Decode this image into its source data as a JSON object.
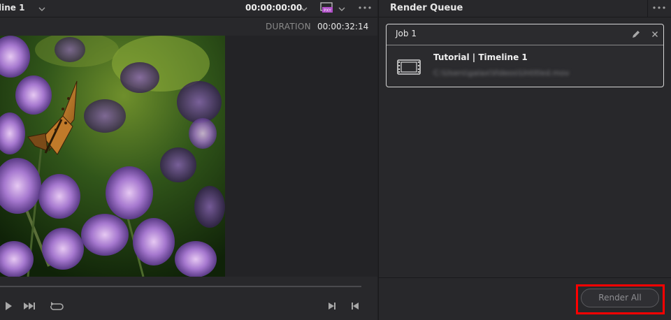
{
  "viewer": {
    "timeline_name": "line 1",
    "timecode": "00:00:00:00",
    "duration_label": "DURATION",
    "duration_value": "00:00:32:14",
    "proxy_badge": "PXY"
  },
  "queue": {
    "title": "Render Queue",
    "jobs": [
      {
        "title": "Job 1",
        "name": "Tutorial | Timeline 1",
        "path": "C:\\Users\\galax\\Videos\\Untitled.mov"
      }
    ],
    "render_all_label": "Render All"
  },
  "icons": [
    "chevron-down-icon",
    "proxy-icon",
    "more-options-icon",
    "play-icon",
    "fast-forward-icon",
    "loop-icon",
    "jump-to-end-icon",
    "jump-to-start-icon",
    "edit-pencil-icon",
    "close-icon",
    "film-strip-icon"
  ],
  "colors": {
    "highlight": "#ff0000",
    "panel": "#28282b",
    "background": "#1f1f22"
  }
}
